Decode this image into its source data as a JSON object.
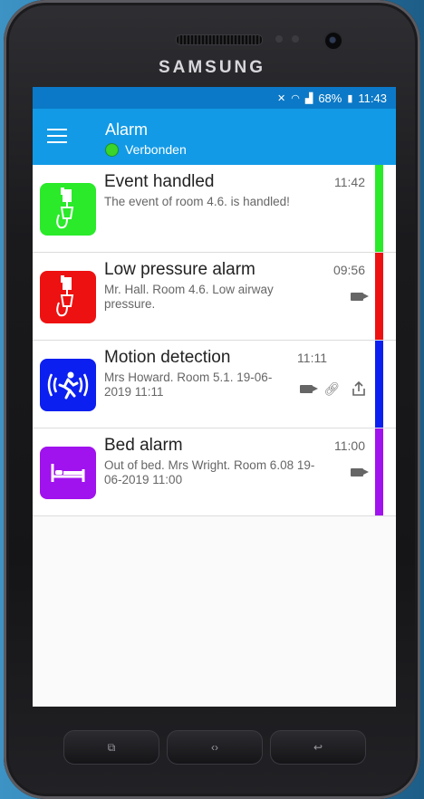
{
  "device": {
    "brand": "SAMSUNG"
  },
  "statusbar": {
    "battery": "68%",
    "time": "11:43"
  },
  "appbar": {
    "title": "Alarm",
    "connection": "Verbonden",
    "connection_color": "#3bd42a"
  },
  "alarms": [
    {
      "title": "Event handled",
      "description": "The event of room 4.6. is handled!",
      "time": "11:42",
      "color": "#2aea2a",
      "icon": "iv-drip-icon",
      "actions": []
    },
    {
      "title": "Low pressure alarm",
      "description": "Mr. Hall. Room 4.6. Low airway pressure.",
      "time": "09:56",
      "color": "#ee1111",
      "icon": "iv-drip-icon",
      "actions": [
        "video-icon"
      ]
    },
    {
      "title": "Motion detection",
      "description": "Mrs Howard. Room 5.1. 19-06-2019 11:11",
      "time": "11:11",
      "color": "#0b1ff0",
      "icon": "running-person-icon",
      "actions": [
        "video-icon",
        "link-icon",
        "share-icon"
      ]
    },
    {
      "title": "Bed alarm",
      "description": "Out of bed. Mrs Wright. Room 6.08 19-06-2019 11:00",
      "time": "11:00",
      "color": "#a012ee",
      "icon": "bed-icon",
      "actions": [
        "video-icon"
      ]
    }
  ]
}
